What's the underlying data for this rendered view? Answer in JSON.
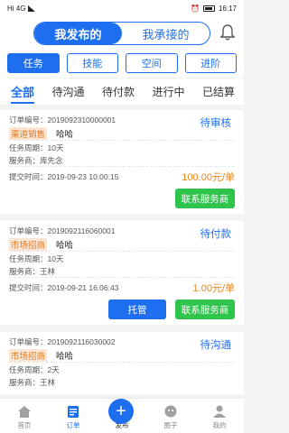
{
  "status_bar": {
    "left": "Hi 4G",
    "time": "16:17"
  },
  "header": {
    "seg_active": "我发布的",
    "seg_other": "我承接的"
  },
  "categories": [
    "任务",
    "技能",
    "空间",
    "进阶"
  ],
  "tabs": [
    "全部",
    "待沟通",
    "待付款",
    "进行中",
    "已结算"
  ],
  "orders": [
    {
      "order_no": "订单编号：2019092310000001",
      "status": "待审核",
      "tag": "渠道销售",
      "name": "哈哈",
      "period": "任务周期：10天",
      "provider": "服务商：库先念",
      "submit_time": "提交时间：2019-09-23 10:00:15",
      "price": "100.00元/单",
      "buttons": [
        "联系服务商"
      ]
    },
    {
      "order_no": "订单编号：2019092116060001",
      "status": "待付款",
      "tag": "市场招商",
      "name": "哈哈",
      "period": "任务周期：10天",
      "provider": "服务商：王林",
      "submit_time": "提交时间：2019-09-21 16:06:43",
      "price": "1.00元/单",
      "buttons": [
        "托管",
        "联系服务商"
      ]
    },
    {
      "order_no": "订单编号：2019092116030002",
      "status": "待沟通",
      "tag": "市场招商",
      "name": "哈哈",
      "period": "任务周期：2天",
      "provider": "服务商：王林"
    }
  ],
  "bottom_nav": [
    "首页",
    "订单",
    "发布",
    "圈子",
    "我的"
  ],
  "colors": {
    "primary": "#1e6ff0",
    "green": "#2fc54d",
    "orange": "#e8851a"
  }
}
